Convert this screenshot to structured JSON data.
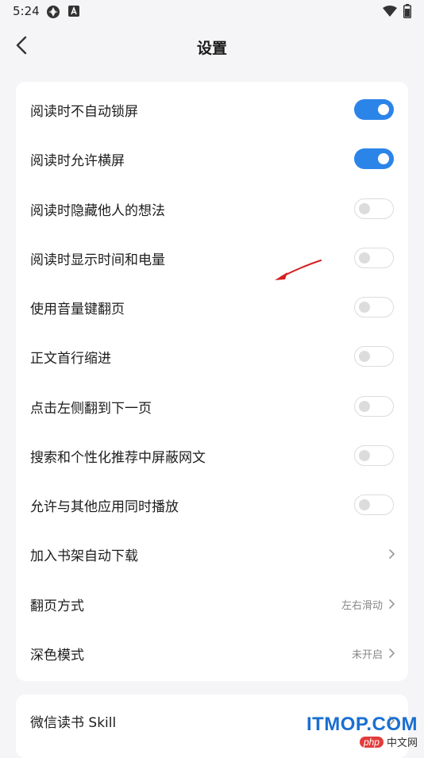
{
  "status_bar": {
    "time": "5:24",
    "icons": [
      "aperture-icon",
      "a-badge-icon",
      "wifi-icon",
      "battery-icon"
    ]
  },
  "header": {
    "title": "设置",
    "back_icon": "chevron-left-icon"
  },
  "settings": [
    {
      "label": "阅读时不自动锁屏",
      "control": "toggle",
      "state": "on"
    },
    {
      "label": "阅读时允许横屏",
      "control": "toggle",
      "state": "on"
    },
    {
      "label": "阅读时隐藏他人的想法",
      "control": "toggle",
      "state": "off"
    },
    {
      "label": "阅读时显示时间和电量",
      "control": "toggle",
      "state": "off"
    },
    {
      "label": "使用音量键翻页",
      "control": "toggle",
      "state": "off"
    },
    {
      "label": "正文首行缩进",
      "control": "toggle",
      "state": "off"
    },
    {
      "label": "点击左侧翻到下一页",
      "control": "toggle",
      "state": "off"
    },
    {
      "label": "搜索和个性化推荐中屏蔽网文",
      "control": "toggle",
      "state": "off"
    },
    {
      "label": "允许与其他应用同时播放",
      "control": "toggle",
      "state": "off"
    },
    {
      "label": "加入书架自动下载",
      "control": "chevron",
      "value": ""
    },
    {
      "label": "翻页方式",
      "control": "chevron",
      "value": "左右滑动"
    },
    {
      "label": "深色模式",
      "control": "chevron",
      "value": "未开启"
    }
  ],
  "second_card": [
    {
      "label": "微信读书 Skill",
      "control": "chevron",
      "value": ""
    }
  ],
  "colors": {
    "accent": "#2b84e8",
    "background": "#f5f5f7",
    "card": "#ffffff",
    "annotation_arrow": "#d42020"
  },
  "watermark": {
    "main": "ITMOP.COM",
    "badge": "php",
    "sub": "中文网"
  }
}
